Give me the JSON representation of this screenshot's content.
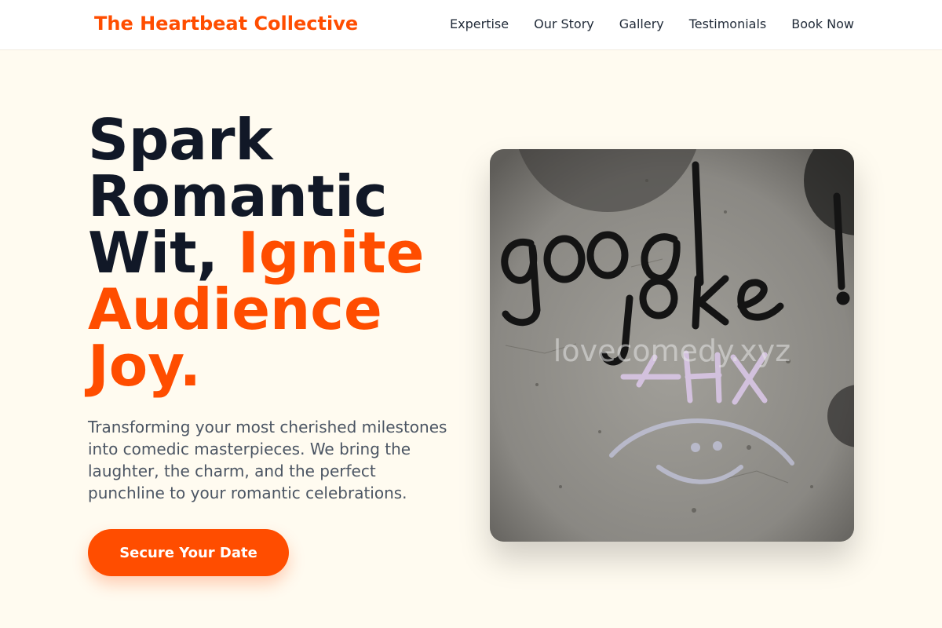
{
  "nav": {
    "brand": "The Heartbeat Collective",
    "links": [
      "Expertise",
      "Our Story",
      "Gallery",
      "Testimonials",
      "Book Now"
    ]
  },
  "hero": {
    "title_plain": "Spark Romantic Wit,",
    "title_accent": "Ignite Audience Joy.",
    "subtitle": "Transforming your most cherished milestones into comedic masterpieces. We bring the laughter, the charm, and the perfect punchline to your romantic celebrations.",
    "cta_label": "Secure Your Date",
    "image": {
      "graffiti_text": "good joke! thx",
      "watermark": "lovecomedy.xyz"
    }
  },
  "colors": {
    "accent": "#ff4d00",
    "heading": "#111827",
    "background": "#fffbf0"
  }
}
